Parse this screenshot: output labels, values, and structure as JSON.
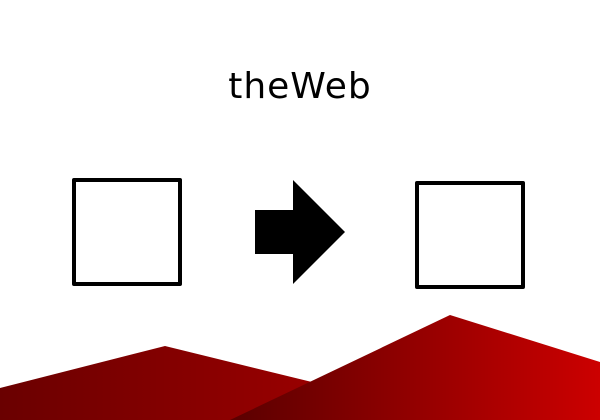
{
  "title": "theWeb",
  "icons": {
    "source": "empty-square-icon",
    "arrow": "right-arrow-icon",
    "target": "empty-square-icon",
    "background": "red-mountains"
  },
  "colors": {
    "background": "#ffffff",
    "ink": "#000000",
    "mountain_dark": "#5a0000",
    "mountain_bright": "#cc0000"
  }
}
